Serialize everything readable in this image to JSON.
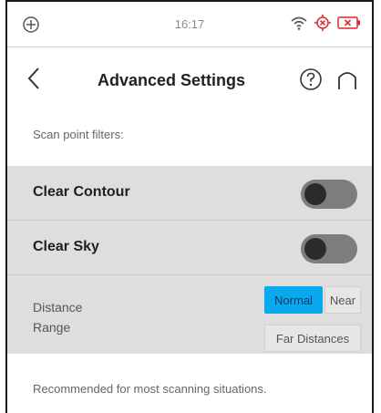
{
  "status_bar": {
    "time": "16:17",
    "left_icon": "crosshair-plus-icon",
    "right_icons": [
      "wifi-icon",
      "target-error-icon",
      "battery-error-icon"
    ],
    "colors": {
      "error": "#e0262b",
      "text": "#8a8a8a"
    }
  },
  "nav": {
    "title": "Advanced Settings",
    "back_icon": "chevron-left-icon",
    "help_icon": "help-circle-icon",
    "home_icon": "home-icon"
  },
  "filters": {
    "section_label": "Scan point filters:",
    "clear_contour": {
      "label": "Clear Contour",
      "enabled": false
    },
    "clear_sky": {
      "label": "Clear Sky",
      "enabled": false
    }
  },
  "distance_range": {
    "label_line1": "Distance",
    "label_line2": "Range",
    "options": [
      "Normal",
      "Near",
      "Far Distances"
    ],
    "selected": "Normal",
    "accent_color": "#0aa8ef"
  },
  "description": "Recommended for most scanning situations."
}
